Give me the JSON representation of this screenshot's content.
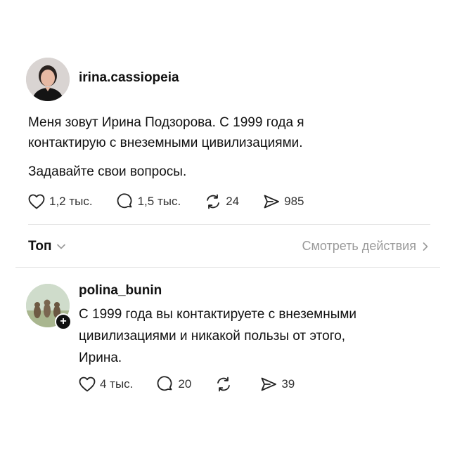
{
  "post": {
    "username": "irina.cassiopeia",
    "text_line_1": "Меня зовут Ирина Подзорова. С 1999 года я",
    "text_line_2": "контактирую с внеземными цивилизациями.",
    "text_line_3": "Задавайте свои вопросы.",
    "likes": "1,2 тыс.",
    "comments": "1,5 тыс.",
    "reposts": "24",
    "shares": "985"
  },
  "sort": {
    "label": "Топ",
    "view_activity": "Смотреть действия"
  },
  "reply": {
    "username": "polina_bunin",
    "text_line_1": "С 1999 года вы контактируете с внеземными",
    "text_line_2": "цивилизациями и никакой пользы от этого,",
    "text_line_3": "Ирина.",
    "likes": "4 тыс.",
    "comments": "20",
    "shares": "39"
  },
  "icons": {
    "like": "heart-icon",
    "comment": "comment-bubble-icon",
    "repost": "repost-icon",
    "share": "send-icon",
    "sort_chevron": "chevron-down-icon",
    "view_chevron": "chevron-right-icon",
    "follow": "plus-icon"
  }
}
